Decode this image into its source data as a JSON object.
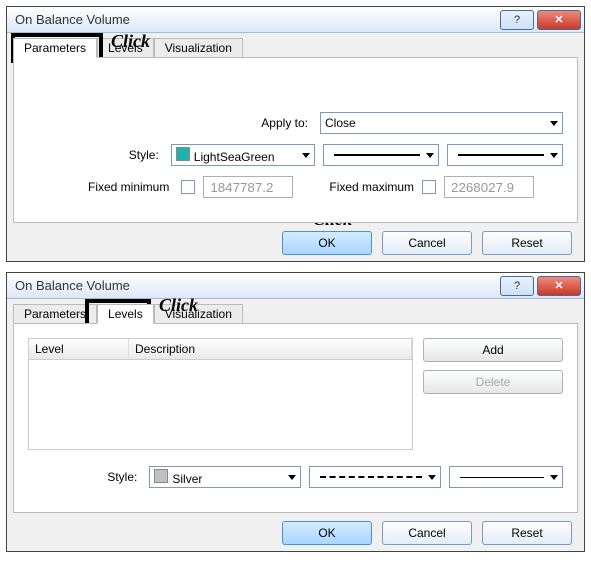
{
  "win1": {
    "title": "On Balance Volume",
    "tabs": {
      "parameters": "Parameters",
      "levels": "Levels",
      "visualization": "Visualization"
    },
    "apply_label": "Apply to:",
    "apply_value": "Close",
    "style_label": "Style:",
    "style_value": "LightSeaGreen",
    "style_color": "#20b2aa",
    "fixed_min_label": "Fixed minimum",
    "fixed_min_value": "1847787.2",
    "fixed_max_label": "Fixed maximum",
    "fixed_max_value": "2268027.9",
    "ok": "OK",
    "cancel": "Cancel",
    "reset": "Reset"
  },
  "win2": {
    "title": "On Balance Volume",
    "tabs": {
      "parameters": "Parameters",
      "levels": "Levels",
      "visualization": "Visualization"
    },
    "col_level": "Level",
    "col_desc": "Description",
    "add": "Add",
    "delete": "Delete",
    "style_label": "Style:",
    "style_value": "Silver",
    "style_color": "#c0c0c0",
    "ok": "OK",
    "cancel": "Cancel",
    "reset": "Reset"
  },
  "anno": {
    "click": "Click"
  }
}
